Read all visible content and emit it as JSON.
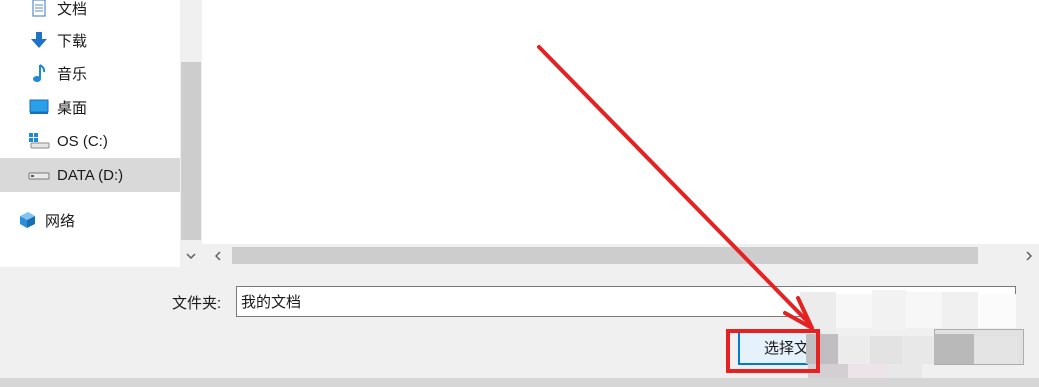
{
  "sidebar": {
    "items": [
      {
        "label": "文档",
        "icon": "document-icon"
      },
      {
        "label": "下载",
        "icon": "download-arrow-icon"
      },
      {
        "label": "音乐",
        "icon": "music-note-icon"
      },
      {
        "label": "桌面",
        "icon": "desktop-icon"
      },
      {
        "label": "OS (C:)",
        "icon": "windows-drive-icon"
      },
      {
        "label": "DATA (D:)",
        "icon": "drive-icon",
        "selected": true
      },
      {
        "label": "网络",
        "icon": "network-icon"
      }
    ]
  },
  "footer": {
    "folder_label": "文件夹:",
    "folder_value": "我的文档",
    "select_button_label": "选择文"
  },
  "colors": {
    "annotation": "#e52121",
    "accent": "#0078d7",
    "selection": "#d9d9d9"
  }
}
